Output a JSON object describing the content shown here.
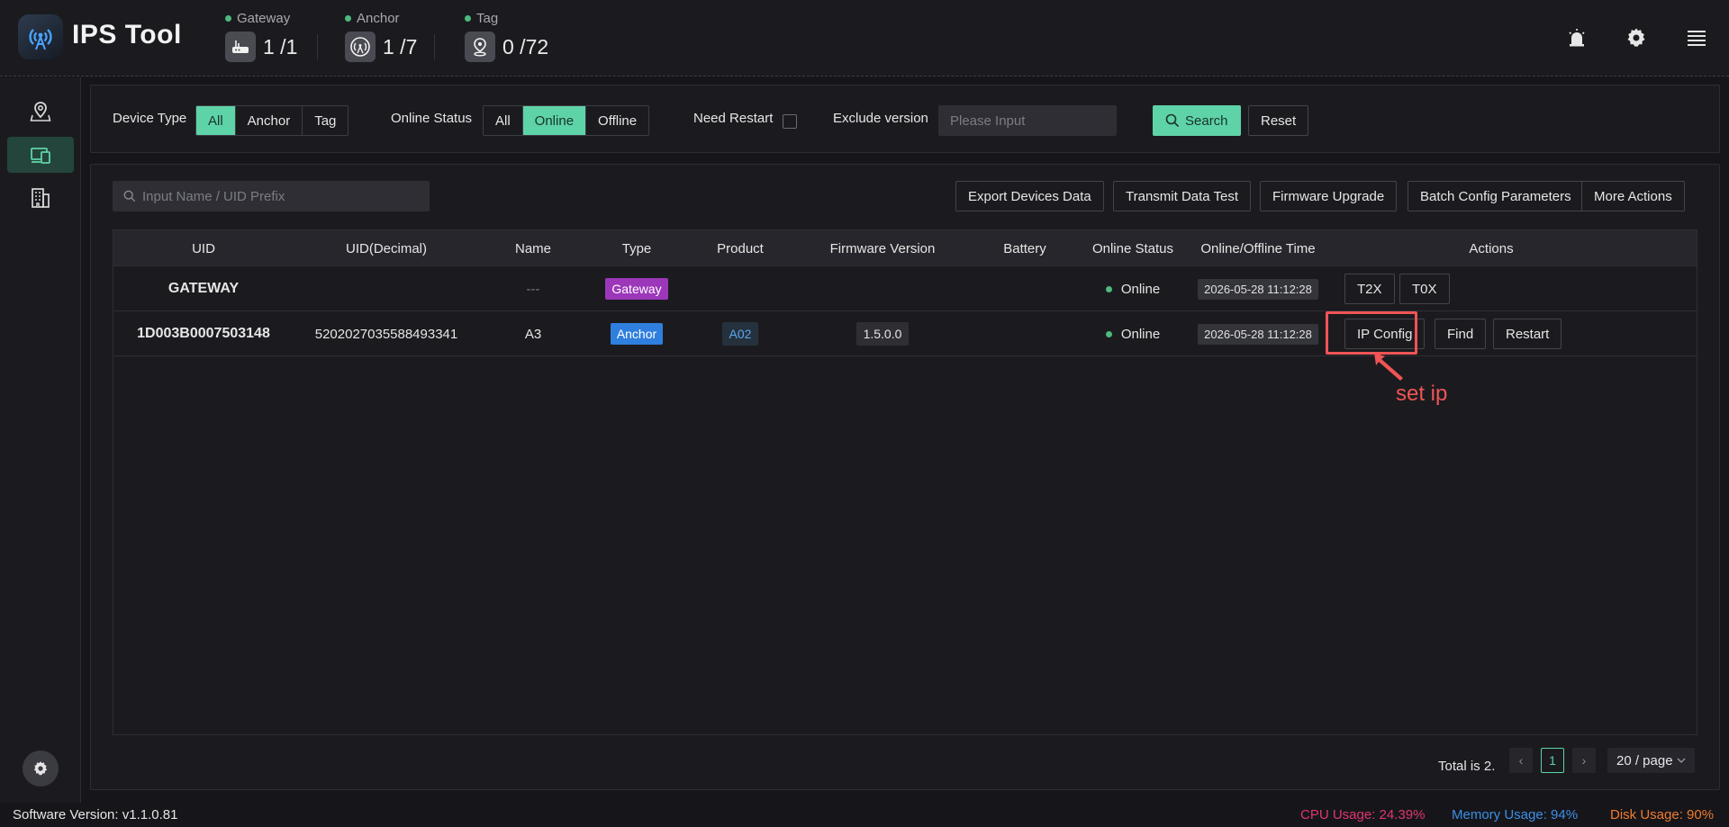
{
  "app": {
    "title": "IPS Tool"
  },
  "header_stats": [
    {
      "label": "Gateway",
      "value": "1 /1",
      "icon": "router-icon"
    },
    {
      "label": "Anchor",
      "value": "1 /7",
      "icon": "antenna-icon"
    },
    {
      "label": "Tag",
      "value": "0 /72",
      "icon": "map-pin-icon"
    }
  ],
  "header_icons": [
    "alarm-icon",
    "gear-icon",
    "menu-icon"
  ],
  "sidebar": {
    "items": [
      {
        "icon": "map-location-icon",
        "active": false
      },
      {
        "icon": "devices-icon",
        "active": true
      },
      {
        "icon": "building-icon",
        "active": false
      }
    ],
    "bottom_icon": "settings-icon"
  },
  "filters": {
    "device_type": {
      "label": "Device Type",
      "options": [
        "All",
        "Anchor",
        "Tag"
      ],
      "selected": "All"
    },
    "online_status": {
      "label": "Online Status",
      "options": [
        "All",
        "Online",
        "Offline"
      ],
      "selected": "Online"
    },
    "need_restart": {
      "label": "Need Restart",
      "checked": false
    },
    "exclude_version": {
      "label": "Exclude version",
      "placeholder": "Please Input"
    },
    "search_label": "Search",
    "reset_label": "Reset"
  },
  "toolbar": {
    "search_placeholder": "Input Name / UID Prefix",
    "actions": [
      "Export Devices Data",
      "Transmit Data Test",
      "Firmware Upgrade",
      "Batch Config Parameters",
      "More Actions"
    ]
  },
  "table": {
    "columns": [
      "UID",
      "UID(Decimal)",
      "Name",
      "Type",
      "Product",
      "Firmware Version",
      "Battery",
      "Online Status",
      "Online/Offline Time",
      "Actions"
    ],
    "rows": [
      {
        "uid": "GATEWAY",
        "uid_decimal": "",
        "name": "---",
        "type": "Gateway",
        "product": "",
        "firmware": "",
        "battery": "",
        "status": "Online",
        "time": "2026-05-28 11:12:28",
        "actions": [
          "T2X",
          "T0X"
        ]
      },
      {
        "uid": "1D003B0007503148",
        "uid_decimal": "5202027035588493341",
        "name": "A3",
        "type": "Anchor",
        "product": "A02",
        "firmware": "1.5.0.0",
        "battery": "",
        "status": "Online",
        "time": "2026-05-28 11:12:28",
        "actions": [
          "IP Config",
          "Find",
          "Restart"
        ]
      }
    ]
  },
  "annotation": {
    "text": "set ip",
    "color": "#f05454"
  },
  "pagination": {
    "total_text": "Total is 2.",
    "current_page": "1",
    "page_size": "20 / page",
    "prev": "‹",
    "next": "›"
  },
  "footer": {
    "software_version": "Software Version:  v1.1.0.81",
    "cpu": "CPU Usage:  24.39%",
    "memory": "Memory Usage:  94%",
    "disk": "Disk Usage:  90%",
    "colors": {
      "cpu": "#e0356f",
      "memory": "#3d8fe6",
      "disk": "#f07a2e"
    }
  },
  "colors": {
    "accent": "#5fd3a8",
    "gateway_tag": "#9c37b9",
    "anchor_tag": "#2f7fde",
    "online_dot": "#4fb97f"
  }
}
